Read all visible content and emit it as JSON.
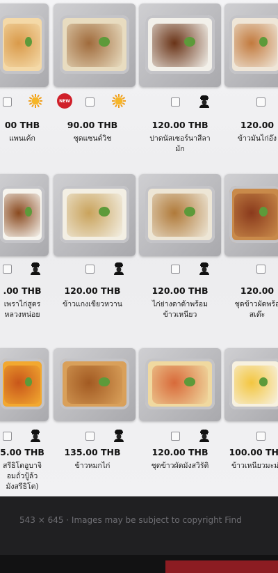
{
  "items": [
    {
      "price": "00 THB",
      "name_lines": [
        "แพนเค้ก"
      ],
      "badge": "sun",
      "colors": [
        "#f4d9a8",
        "#d99a4a"
      ]
    },
    {
      "price": "90.00 THB",
      "name_lines": [
        "ชุดแซนด์วิช"
      ],
      "badge": "new-sun",
      "new_label": "NEW",
      "colors": [
        "#e8dcc0",
        "#a06b3c"
      ]
    },
    {
      "price": "120.00 THB",
      "name_lines": [
        "ปาดนัสเซอร์นาสีลา",
        "มัก"
      ],
      "badge": "chef",
      "colors": [
        "#f2f0ea",
        "#6a3418"
      ]
    },
    {
      "price": "120.00",
      "name_lines": [
        "ข้าวมันไก่อ๊ง"
      ],
      "badge": "none",
      "colors": [
        "#efe6d8",
        "#c27a3e"
      ]
    },
    {
      "price": ".00 THB",
      "name_lines": [
        "เพราไก่สูตร",
        "หลวงหน่อย"
      ],
      "badge": "chef",
      "colors": [
        "#f6f4ee",
        "#8a4a20"
      ]
    },
    {
      "price": "120.00 THB",
      "name_lines": [
        "ข้าวแกงเขียวหวาน"
      ],
      "badge": "chef",
      "colors": [
        "#f3efe4",
        "#c9a35c"
      ]
    },
    {
      "price": "120.00 THB",
      "name_lines": [
        "ไก่ย่างดาด้าพร้อม",
        "ข้าวเหนียว"
      ],
      "badge": "chef",
      "colors": [
        "#ede6d6",
        "#b07a3a"
      ]
    },
    {
      "price": "120.00",
      "name_lines": [
        "ชุดข้าวผัดพร้อ",
        "สเต๊ะ"
      ],
      "badge": "none",
      "colors": [
        "#c98a4a",
        "#8a3a1c"
      ]
    },
    {
      "price": "5.00 THB",
      "name_lines": [
        "สรีธิโตอูบาจิ",
        "อมถั่วปู้ล้ว",
        "มังสรีธิโต)"
      ],
      "badge": "chef",
      "colors": [
        "#f2a830",
        "#c8561a"
      ]
    },
    {
      "price": "135.00 THB",
      "name_lines": [
        "ข้าวหมกไก่"
      ],
      "badge": "chef",
      "colors": [
        "#d9a05a",
        "#a25a22"
      ]
    },
    {
      "price": "120.00 THB",
      "name_lines": [
        "ชุดข้าวผัดมังสวิรัติ"
      ],
      "badge": "chef",
      "colors": [
        "#f0d9a0",
        "#d86a3a"
      ]
    },
    {
      "price": "100.00 THB",
      "name_lines": [
        "ข้าวเหนียวมะม่ว"
      ],
      "badge": "red",
      "colors": [
        "#f7f1e0",
        "#f3c640"
      ]
    }
  ],
  "footer": {
    "caption": "543 × 645  ·  Images may be subject to copyright  Find"
  }
}
